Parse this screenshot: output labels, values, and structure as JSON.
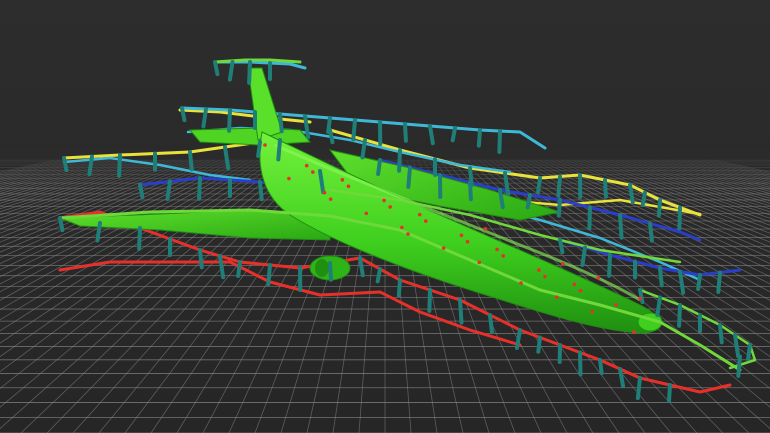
{
  "viewport": {
    "background": "#2b2b2b",
    "grid_color": "#8a8a8a"
  },
  "model": {
    "subject": "aircraft",
    "fuselage_color": "#3fcf1e",
    "fuselage_dark": "#24a012",
    "fuselage_light": "#6ef03a"
  },
  "wireframe": {
    "colors": {
      "yellow": "#e8e23a",
      "cyan": "#3fb8d8",
      "blue": "#2a3fc8",
      "green": "#6fd83a",
      "red": "#e8302a",
      "marker": "#1f7f78"
    }
  }
}
